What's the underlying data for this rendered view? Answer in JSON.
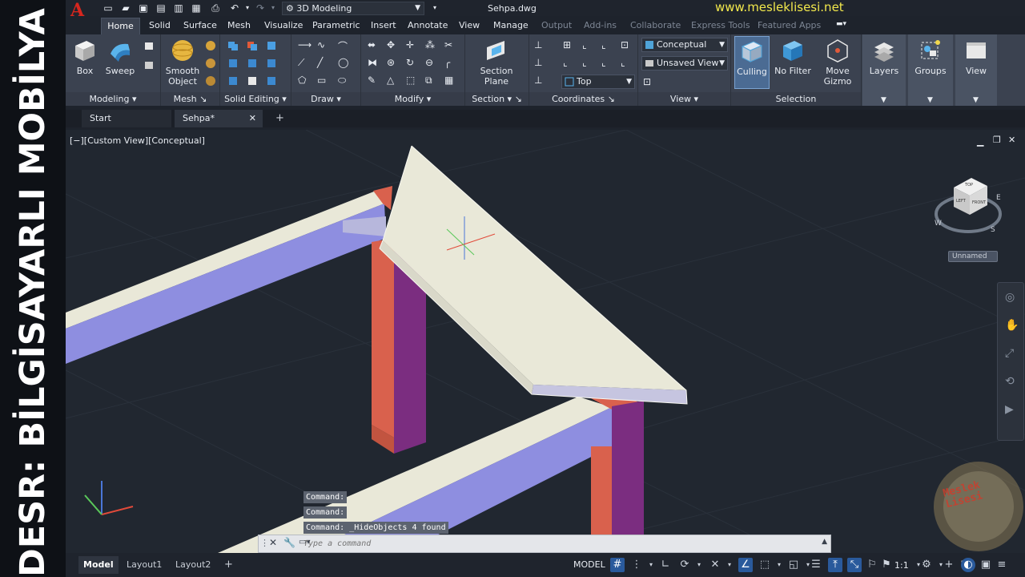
{
  "banner": {
    "text": "DESR: BİLGİSAYARLI MOBİLYA RESMİ"
  },
  "titlebar": {
    "logo": "A",
    "workspace": "3D Modeling",
    "filename": "Sehpa.dwg",
    "website": "www.mesleklisesi.net"
  },
  "ribbon_tabs": [
    "Home",
    "Solid",
    "Surface",
    "Mesh",
    "Visualize",
    "Parametric",
    "Insert",
    "Annotate",
    "View",
    "Manage",
    "Output",
    "Add-ins",
    "Collaborate",
    "Express Tools",
    "Featured Apps"
  ],
  "ribbon": {
    "modeling": {
      "title": "Modeling",
      "box": "Box",
      "sweep": "Sweep"
    },
    "mesh": {
      "title": "Mesh",
      "smooth_line1": "Smooth",
      "smooth_line2": "Object"
    },
    "solid_editing": {
      "title": "Solid Editing"
    },
    "draw": {
      "title": "Draw"
    },
    "modify": {
      "title": "Modify"
    },
    "section": {
      "title": "Section",
      "line1": "Section",
      "line2": "Plane"
    },
    "coordinates": {
      "title": "Coordinates",
      "ucs_combo": "Top"
    },
    "view": {
      "title": "View",
      "visual_style": "Conceptual",
      "saved_view": "Unsaved View"
    },
    "selection": {
      "title": "Selection",
      "culling": "Culling",
      "no_filter": "No Filter",
      "move_line1": "Move",
      "move_line2": "Gizmo"
    },
    "layers": "Layers",
    "groups": "Groups",
    "view_panel": "View"
  },
  "doc_tabs": {
    "start": "Start",
    "active": "Sehpa*"
  },
  "viewport": {
    "label": "[−][Custom View][Conceptual]",
    "viewcube": {
      "top": "TOP",
      "front": "FRONT",
      "left": "LEFT",
      "w": "W",
      "s": "S",
      "e": "E",
      "ucs": "Unnamed"
    },
    "watermark": {
      "line1": "Meslek",
      "line2": "Lisesi"
    }
  },
  "colors": {
    "top_face": "#e9e8d8",
    "side_blue": "#8e8ee0",
    "leg_red": "#d9614d",
    "leg_purple": "#7b2d80",
    "accent": "#2a5a9c"
  },
  "command": {
    "history": [
      "Command:",
      "Command:",
      "Command: _HideObjects 4 found"
    ],
    "placeholder": "Type a command"
  },
  "status": {
    "layouts": [
      "Model",
      "Layout1",
      "Layout2"
    ],
    "model": "MODEL",
    "scale": "1:1"
  }
}
